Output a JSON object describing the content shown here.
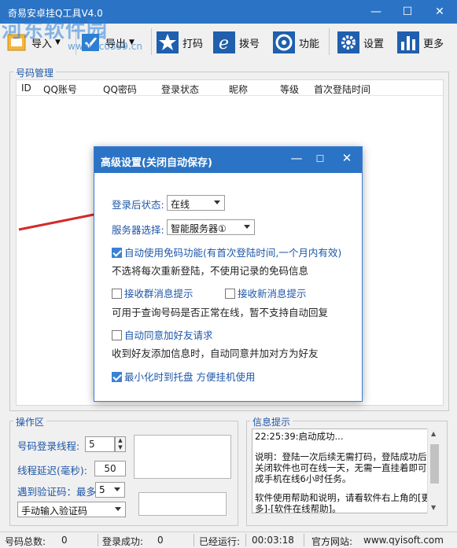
{
  "window": {
    "title": "奇易安卓挂Q工具V4.0",
    "minimize": "—",
    "maximize": "☐",
    "close": "✕"
  },
  "watermark": {
    "logo": "河东软件园",
    "url": "www.pc0359.cn"
  },
  "toolbar": {
    "import": "导入",
    "export": "导出",
    "captcha": "打码",
    "dial": "拨号",
    "features": "功能",
    "settings": "设置",
    "more": "更多"
  },
  "accounts": {
    "group_title": "号码管理",
    "columns": [
      "ID",
      "QQ账号",
      "QQ密码",
      "登录状态",
      "昵称",
      "等级",
      "首次登陆时间"
    ]
  },
  "dialog": {
    "title": "高级设置(关闭自动保存)",
    "status_label": "登录后状态:",
    "status_value": "在线",
    "server_label": "服务器选择:",
    "server_value": "智能服务器①",
    "no_captcha_label": "自动使用免码功能(有首次登陆时间,一个月内有效)",
    "no_captcha_note": "不选将每次重新登陆，不使用记录的免码信息",
    "recv_group_label": "接收群消息提示",
    "recv_new_label": "接收新消息提示",
    "recv_note": "可用于查询号码是否正常在线，暂不支持自动回复",
    "auto_friend_label": "自动同意加好友请求",
    "auto_friend_note": "收到好友添加信息时，自动同意并加对方为好友",
    "tray_label": "最小化时到托盘  方便挂机使用"
  },
  "operation": {
    "group_title": "操作区",
    "threads_label": "号码登录线程:",
    "threads_value": "5",
    "delay_label": "线程延迟(毫秒):",
    "delay_value": "50",
    "captcha_label": "遇到验证码：最多",
    "captcha_max": "5",
    "captcha_mode": "手动输入验证码"
  },
  "info": {
    "group_title": "信息提示",
    "lines": [
      "22:25:39:启动成功...",
      "说明：登陆一次后续无需打码，登陆成功后，关闭软件也可在线一天，无需一直挂着即可完成手机在线6小时任务。",
      "软件使用帮助和说明，请看软件右上角的[更多]-[软件在线帮助]。"
    ]
  },
  "status": {
    "total_label": "号码总数:",
    "total_value": "0",
    "success_label": "登录成功:",
    "success_value": "0",
    "runtime_label": "已经运行:",
    "runtime_value": "00:03:18",
    "site_label": "官方网站:",
    "site_value": "www.qyisoft.com"
  },
  "colors": {
    "title_bar": "#2b74c5",
    "label_blue": "#1e57a8",
    "arrow_red": "#d42a2a"
  }
}
